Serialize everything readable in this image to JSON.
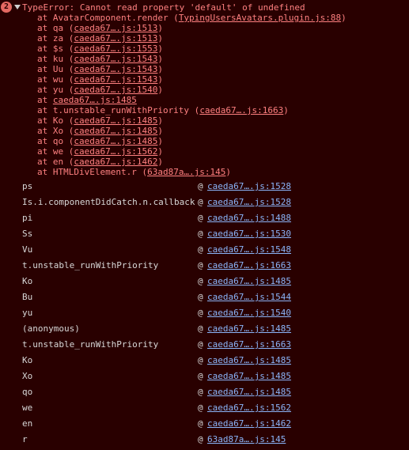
{
  "error": {
    "count": "2",
    "message": "TypeError: Cannot read property 'default' of undefined",
    "frames": [
      {
        "prefix": "at AvatarComponent.render (",
        "link": "TypingUsersAvatars.plugin.js:88",
        "suffix": ")"
      },
      {
        "prefix": "at qa (",
        "link": "caeda67….js:1513",
        "suffix": ")"
      },
      {
        "prefix": "at za (",
        "link": "caeda67….js:1513",
        "suffix": ")"
      },
      {
        "prefix": "at $s (",
        "link": "caeda67….js:1553",
        "suffix": ")"
      },
      {
        "prefix": "at ku (",
        "link": "caeda67….js:1543",
        "suffix": ")"
      },
      {
        "prefix": "at Uu (",
        "link": "caeda67….js:1543",
        "suffix": ")"
      },
      {
        "prefix": "at wu (",
        "link": "caeda67….js:1543",
        "suffix": ")"
      },
      {
        "prefix": "at yu (",
        "link": "caeda67….js:1540",
        "suffix": ")"
      },
      {
        "prefix": "at ",
        "link": "caeda67….js:1485",
        "suffix": ""
      },
      {
        "prefix": "at t.unstable_runWithPriority (",
        "link": "caeda67….js:1663",
        "suffix": ")"
      },
      {
        "prefix": "at Ko (",
        "link": "caeda67….js:1485",
        "suffix": ")"
      },
      {
        "prefix": "at Xo (",
        "link": "caeda67….js:1485",
        "suffix": ")"
      },
      {
        "prefix": "at qo (",
        "link": "caeda67….js:1485",
        "suffix": ")"
      },
      {
        "prefix": "at we (",
        "link": "caeda67….js:1562",
        "suffix": ")"
      },
      {
        "prefix": "at en (",
        "link": "caeda67….js:1462",
        "suffix": ")"
      },
      {
        "prefix": "at HTMLDivElement.r (",
        "link": "63ad87a….js:145",
        "suffix": ")"
      }
    ]
  },
  "callstack": [
    {
      "fn": "ps",
      "link": "caeda67….js:1528"
    },
    {
      "fn": "Is.i.componentDidCatch.n.callback",
      "link": "caeda67….js:1528"
    },
    {
      "fn": "pi",
      "link": "caeda67….js:1488"
    },
    {
      "fn": "Ss",
      "link": "caeda67….js:1530"
    },
    {
      "fn": "Vu",
      "link": "caeda67….js:1548"
    },
    {
      "fn": "t.unstable_runWithPriority",
      "link": "caeda67….js:1663"
    },
    {
      "fn": "Ko",
      "link": "caeda67….js:1485"
    },
    {
      "fn": "Bu",
      "link": "caeda67….js:1544"
    },
    {
      "fn": "yu",
      "link": "caeda67….js:1540"
    },
    {
      "fn": "(anonymous)",
      "link": "caeda67….js:1485"
    },
    {
      "fn": "t.unstable_runWithPriority",
      "link": "caeda67….js:1663"
    },
    {
      "fn": "Ko",
      "link": "caeda67….js:1485"
    },
    {
      "fn": "Xo",
      "link": "caeda67….js:1485"
    },
    {
      "fn": "qo",
      "link": "caeda67….js:1485"
    },
    {
      "fn": "we",
      "link": "caeda67….js:1562"
    },
    {
      "fn": "en",
      "link": "caeda67….js:1462"
    },
    {
      "fn": "r",
      "link": "63ad87a….js:145"
    }
  ],
  "at_symbol": "@"
}
